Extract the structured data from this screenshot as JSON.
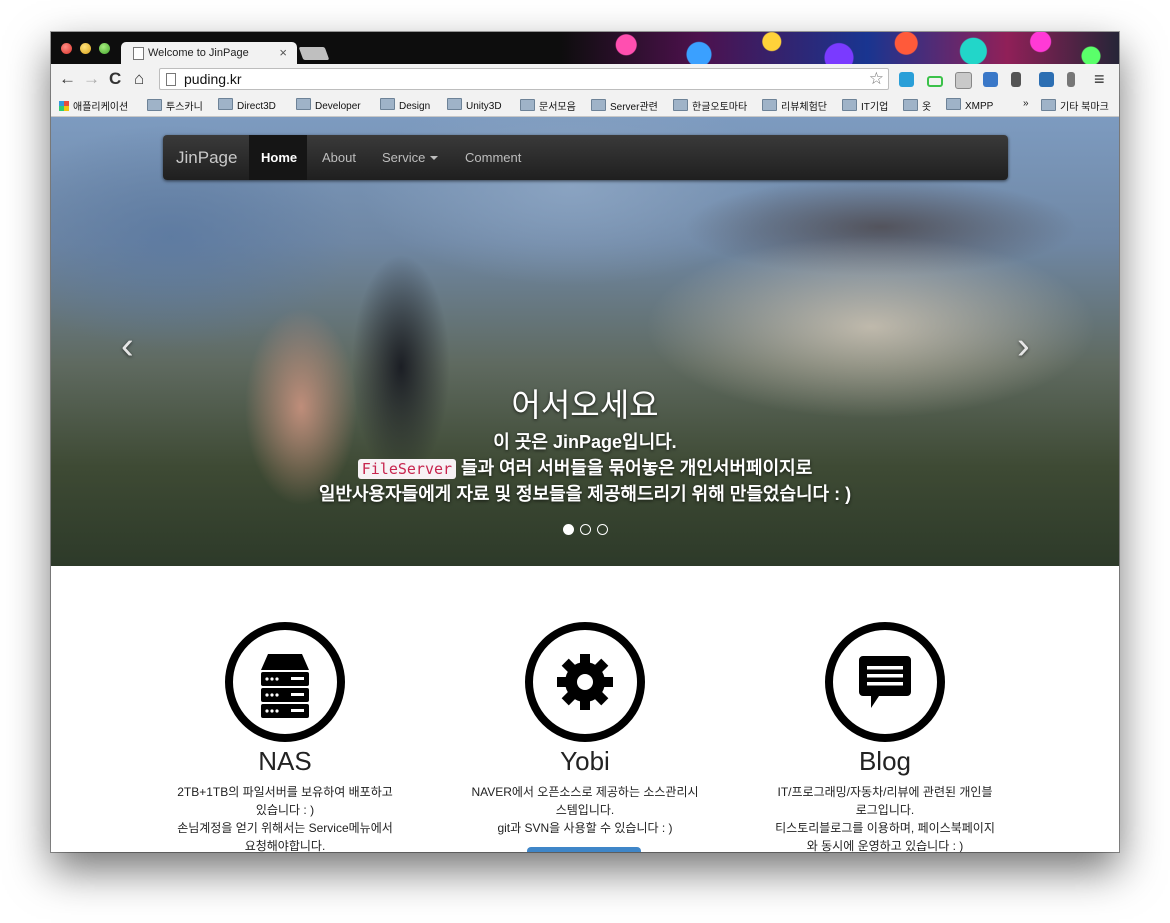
{
  "browser": {
    "tab_title": "Welcome to JinPage",
    "tab_close": "×",
    "url": "puding.kr",
    "star_icon": "☆",
    "menu_icon": "≡",
    "back_icon": "←",
    "forward_icon": "→",
    "reload_icon": "C",
    "home_icon": "⌂"
  },
  "bookmarks": {
    "items": [
      "애플리케이션",
      "투스카니",
      "Direct3D",
      "Developer",
      "Design",
      "Unity3D",
      "문서모음",
      "Server관련",
      "한글오토마타",
      "리뷰체험단",
      "IT기업",
      "옷",
      "XMPP"
    ],
    "overflow": "»",
    "other": "기타 북마크"
  },
  "nav": {
    "brand": "JinPage",
    "home": "Home",
    "about": "About",
    "service": "Service",
    "comment": "Comment"
  },
  "hero": {
    "title": "어서오세요",
    "line1": "이 곳은 JinPage입니다.",
    "code": "FileServer",
    "line2_rest": " 들과 여러 서버들을 묶어놓은 개인서버페이지로",
    "line3": "일반사용자들에게 자료 및 정보들을 제공해드리기 위해 만들었습니다 : )",
    "prev": "‹",
    "next": "›"
  },
  "features": [
    {
      "title": "NAS",
      "line1": "2TB+1TB의 파일서버를 보유하여 배포하고",
      "line2": "있습니다 : )",
      "line3": "손님계정을 얻기 위해서는 Service메뉴에서",
      "line4": "요청해야합니다."
    },
    {
      "title": "Yobi",
      "line1": "NAVER에서 오픈소스로 제공하는 소스관리시",
      "line2": "스템입니다.",
      "line3": "git과 SVN을 사용할 수 있습니다 : )",
      "line4": ""
    },
    {
      "title": "Blog",
      "line1": "IT/프로그래밍/자동차/리뷰에 관련된 개인블",
      "line2": "로그입니다.",
      "line3": "티스토리블로그를 이용하며, 페이스북페이지",
      "line4": "와 동시에 운영하고 있습니다 : )"
    }
  ]
}
